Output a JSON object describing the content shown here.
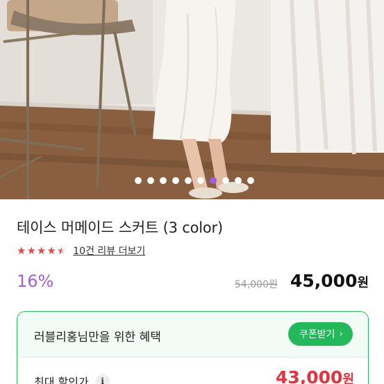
{
  "gallery": {
    "total_images": 10,
    "active_index": 7,
    "colors": {
      "active_dot": "#a05ed8",
      "dot": "#ffffff"
    }
  },
  "product": {
    "title": "테이스 머메이드 스커트 (3 color)",
    "rating": 4.5,
    "review_link": "10건 리뷰 더보기",
    "discount_rate": "16%",
    "original_price": "54,000원",
    "sale_price": "45,000",
    "currency": "원"
  },
  "benefit": {
    "title": "러블리홍님만을 위한 혜택",
    "coupon_button": "쿠폰받기",
    "coupon_chevron": "›",
    "max_discount_label": "최대 할인가",
    "info_icon_glyph": "i",
    "max_discount_price": "43,000",
    "currency": "원",
    "colors": {
      "accent": "#23b85a",
      "price": "#e1343f"
    }
  }
}
